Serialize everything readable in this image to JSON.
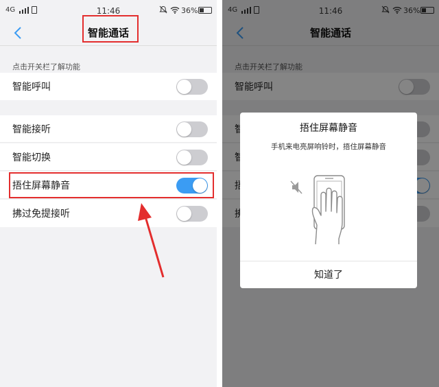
{
  "status_bar": {
    "network": "4G",
    "time": "11:46",
    "battery": "36%"
  },
  "header": {
    "title": "智能通话"
  },
  "section_hint": "点击开关栏了解功能",
  "settings": [
    {
      "label": "智能呼叫",
      "on": false
    },
    {
      "label": "智能接听",
      "on": false
    },
    {
      "label": "智能切换",
      "on": false
    },
    {
      "label": "捂住屏幕静音",
      "on": true
    },
    {
      "label": "拂过免提接听",
      "on": false
    }
  ],
  "dialog": {
    "title": "捂住屏幕静音",
    "message": "手机来电亮屏响铃时，捂住屏幕静音",
    "button": "知道了"
  },
  "colors": {
    "accent": "#3b9cf3",
    "highlight": "#e32d2d",
    "toggle_off": "#cdcdd1"
  }
}
